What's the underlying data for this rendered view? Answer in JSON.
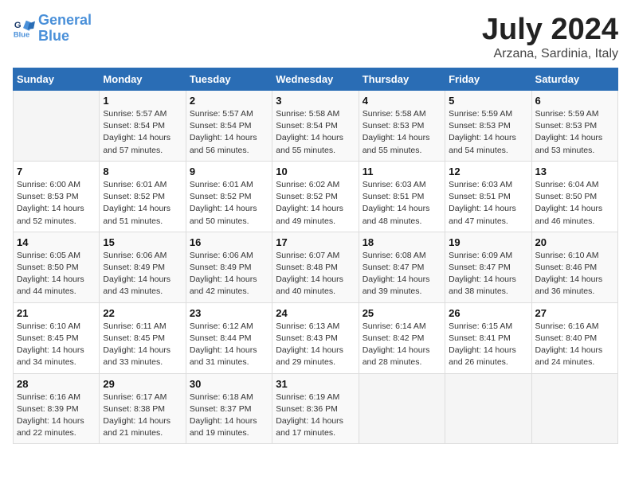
{
  "header": {
    "logo_line1": "General",
    "logo_line2": "Blue",
    "title": "July 2024",
    "subtitle": "Arzana, Sardinia, Italy"
  },
  "weekdays": [
    "Sunday",
    "Monday",
    "Tuesday",
    "Wednesday",
    "Thursday",
    "Friday",
    "Saturday"
  ],
  "weeks": [
    [
      {
        "day": "",
        "info": ""
      },
      {
        "day": "1",
        "info": "Sunrise: 5:57 AM\nSunset: 8:54 PM\nDaylight: 14 hours\nand 57 minutes."
      },
      {
        "day": "2",
        "info": "Sunrise: 5:57 AM\nSunset: 8:54 PM\nDaylight: 14 hours\nand 56 minutes."
      },
      {
        "day": "3",
        "info": "Sunrise: 5:58 AM\nSunset: 8:54 PM\nDaylight: 14 hours\nand 55 minutes."
      },
      {
        "day": "4",
        "info": "Sunrise: 5:58 AM\nSunset: 8:53 PM\nDaylight: 14 hours\nand 55 minutes."
      },
      {
        "day": "5",
        "info": "Sunrise: 5:59 AM\nSunset: 8:53 PM\nDaylight: 14 hours\nand 54 minutes."
      },
      {
        "day": "6",
        "info": "Sunrise: 5:59 AM\nSunset: 8:53 PM\nDaylight: 14 hours\nand 53 minutes."
      }
    ],
    [
      {
        "day": "7",
        "info": "Sunrise: 6:00 AM\nSunset: 8:53 PM\nDaylight: 14 hours\nand 52 minutes."
      },
      {
        "day": "8",
        "info": "Sunrise: 6:01 AM\nSunset: 8:52 PM\nDaylight: 14 hours\nand 51 minutes."
      },
      {
        "day": "9",
        "info": "Sunrise: 6:01 AM\nSunset: 8:52 PM\nDaylight: 14 hours\nand 50 minutes."
      },
      {
        "day": "10",
        "info": "Sunrise: 6:02 AM\nSunset: 8:52 PM\nDaylight: 14 hours\nand 49 minutes."
      },
      {
        "day": "11",
        "info": "Sunrise: 6:03 AM\nSunset: 8:51 PM\nDaylight: 14 hours\nand 48 minutes."
      },
      {
        "day": "12",
        "info": "Sunrise: 6:03 AM\nSunset: 8:51 PM\nDaylight: 14 hours\nand 47 minutes."
      },
      {
        "day": "13",
        "info": "Sunrise: 6:04 AM\nSunset: 8:50 PM\nDaylight: 14 hours\nand 46 minutes."
      }
    ],
    [
      {
        "day": "14",
        "info": "Sunrise: 6:05 AM\nSunset: 8:50 PM\nDaylight: 14 hours\nand 44 minutes."
      },
      {
        "day": "15",
        "info": "Sunrise: 6:06 AM\nSunset: 8:49 PM\nDaylight: 14 hours\nand 43 minutes."
      },
      {
        "day": "16",
        "info": "Sunrise: 6:06 AM\nSunset: 8:49 PM\nDaylight: 14 hours\nand 42 minutes."
      },
      {
        "day": "17",
        "info": "Sunrise: 6:07 AM\nSunset: 8:48 PM\nDaylight: 14 hours\nand 40 minutes."
      },
      {
        "day": "18",
        "info": "Sunrise: 6:08 AM\nSunset: 8:47 PM\nDaylight: 14 hours\nand 39 minutes."
      },
      {
        "day": "19",
        "info": "Sunrise: 6:09 AM\nSunset: 8:47 PM\nDaylight: 14 hours\nand 38 minutes."
      },
      {
        "day": "20",
        "info": "Sunrise: 6:10 AM\nSunset: 8:46 PM\nDaylight: 14 hours\nand 36 minutes."
      }
    ],
    [
      {
        "day": "21",
        "info": "Sunrise: 6:10 AM\nSunset: 8:45 PM\nDaylight: 14 hours\nand 34 minutes."
      },
      {
        "day": "22",
        "info": "Sunrise: 6:11 AM\nSunset: 8:45 PM\nDaylight: 14 hours\nand 33 minutes."
      },
      {
        "day": "23",
        "info": "Sunrise: 6:12 AM\nSunset: 8:44 PM\nDaylight: 14 hours\nand 31 minutes."
      },
      {
        "day": "24",
        "info": "Sunrise: 6:13 AM\nSunset: 8:43 PM\nDaylight: 14 hours\nand 29 minutes."
      },
      {
        "day": "25",
        "info": "Sunrise: 6:14 AM\nSunset: 8:42 PM\nDaylight: 14 hours\nand 28 minutes."
      },
      {
        "day": "26",
        "info": "Sunrise: 6:15 AM\nSunset: 8:41 PM\nDaylight: 14 hours\nand 26 minutes."
      },
      {
        "day": "27",
        "info": "Sunrise: 6:16 AM\nSunset: 8:40 PM\nDaylight: 14 hours\nand 24 minutes."
      }
    ],
    [
      {
        "day": "28",
        "info": "Sunrise: 6:16 AM\nSunset: 8:39 PM\nDaylight: 14 hours\nand 22 minutes."
      },
      {
        "day": "29",
        "info": "Sunrise: 6:17 AM\nSunset: 8:38 PM\nDaylight: 14 hours\nand 21 minutes."
      },
      {
        "day": "30",
        "info": "Sunrise: 6:18 AM\nSunset: 8:37 PM\nDaylight: 14 hours\nand 19 minutes."
      },
      {
        "day": "31",
        "info": "Sunrise: 6:19 AM\nSunset: 8:36 PM\nDaylight: 14 hours\nand 17 minutes."
      },
      {
        "day": "",
        "info": ""
      },
      {
        "day": "",
        "info": ""
      },
      {
        "day": "",
        "info": ""
      }
    ]
  ]
}
